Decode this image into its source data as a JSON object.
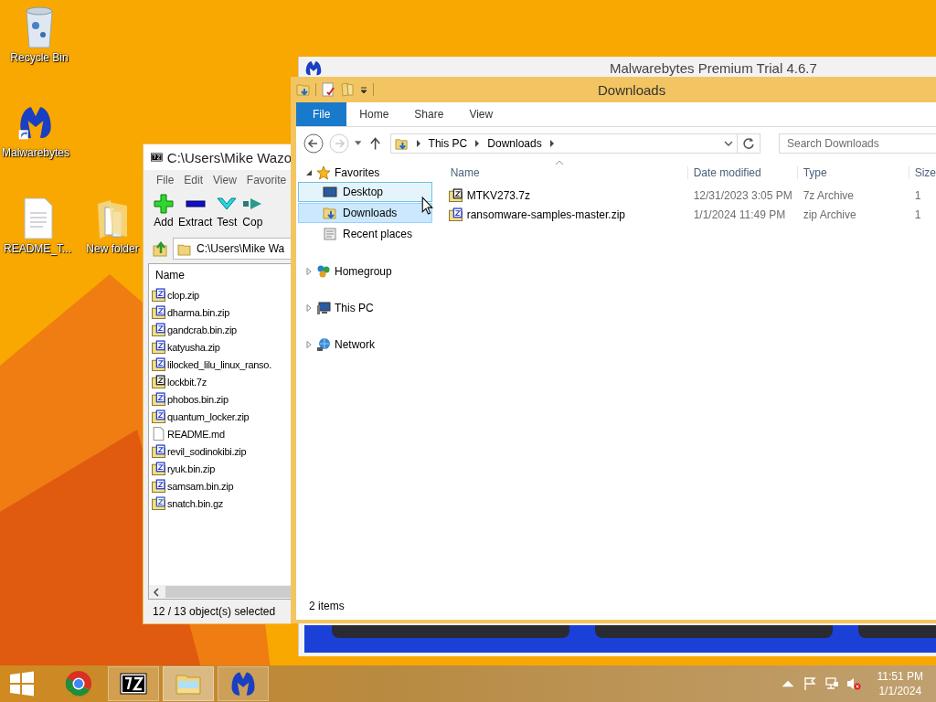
{
  "desktop_icons": [
    {
      "label": "Recycle Bin",
      "kind": "recycle"
    },
    {
      "label": "Malwarebytes",
      "kind": "malwarebytes"
    },
    {
      "label": "README_T...",
      "kind": "document"
    },
    {
      "label": "New folder",
      "kind": "folder"
    }
  ],
  "malwarebytes_window": {
    "title": "Malwarebytes Premium Trial 4.6.7"
  },
  "sevenzip_window": {
    "title": "C:\\Users\\Mike Wazo",
    "menu": [
      "File",
      "Edit",
      "View",
      "Favorite"
    ],
    "toolbar": [
      {
        "label": "Add",
        "kind": "add"
      },
      {
        "label": "Extract",
        "kind": "extract"
      },
      {
        "label": "Test",
        "kind": "test"
      },
      {
        "label": "Cop",
        "kind": "copy"
      }
    ],
    "path": "C:\\Users\\Mike Wa",
    "columns": [
      "Name"
    ],
    "files": [
      {
        "name": "clop.zip",
        "kind": "zip"
      },
      {
        "name": "dharma.bin.zip",
        "kind": "zip"
      },
      {
        "name": "gandcrab.bin.zip",
        "kind": "zip"
      },
      {
        "name": "katyusha.zip",
        "kind": "zip"
      },
      {
        "name": "lilocked_lilu_linux_ranso.",
        "kind": "zip"
      },
      {
        "name": "lockbit.7z",
        "kind": "sevenzip"
      },
      {
        "name": "phobos.bin.zip",
        "kind": "zip"
      },
      {
        "name": "quantum_locker.zip",
        "kind": "zip"
      },
      {
        "name": "README.md",
        "kind": "document"
      },
      {
        "name": "revil_sodinokibi.zip",
        "kind": "zip"
      },
      {
        "name": "ryuk.bin.zip",
        "kind": "zip"
      },
      {
        "name": "samsam.bin.zip",
        "kind": "zip"
      },
      {
        "name": "snatch.bin.gz",
        "kind": "gzip"
      }
    ],
    "status": "12 / 13 object(s) selected"
  },
  "explorer_window": {
    "title": "Downloads",
    "ribbon_tabs": [
      {
        "label": "File",
        "kind": "file"
      },
      {
        "label": "Home",
        "kind": "tab"
      },
      {
        "label": "Share",
        "kind": "tab"
      },
      {
        "label": "View",
        "kind": "tab"
      }
    ],
    "breadcrumb": [
      "This PC",
      "Downloads"
    ],
    "search": {
      "placeholder": "Search Downloads"
    },
    "nav": [
      {
        "label": "Favorites",
        "kind": "favorites",
        "expanded": true,
        "children": [
          {
            "label": "Desktop",
            "kind": "desktop",
            "selected": false,
            "hovered": true
          },
          {
            "label": "Downloads",
            "kind": "downloads",
            "selected": true,
            "hovered": false
          },
          {
            "label": "Recent places",
            "kind": "recent",
            "selected": false,
            "hovered": false
          }
        ]
      },
      {
        "label": "Homegroup",
        "kind": "homegroup",
        "expanded": false
      },
      {
        "label": "This PC",
        "kind": "pc",
        "expanded": false
      },
      {
        "label": "Network",
        "kind": "network",
        "expanded": false
      }
    ],
    "columns": [
      "Name",
      "Date modified",
      "Type",
      "Size"
    ],
    "files": [
      {
        "name": "MTKV273.7z",
        "kind": "sevenzip",
        "date": "12/31/2023 3:05 PM",
        "type": "7z Archive",
        "size": "1"
      },
      {
        "name": "ransomware-samples-master.zip",
        "kind": "zip",
        "date": "1/1/2024 11:49 PM",
        "type": "zip Archive",
        "size": "1"
      }
    ],
    "status": "2 items"
  },
  "taskbar": {
    "apps": [
      {
        "kind": "chrome",
        "running": false,
        "selected": false
      },
      {
        "kind": "sevenzip",
        "running": true,
        "selected": false
      },
      {
        "kind": "explorer",
        "running": true,
        "selected": true
      },
      {
        "kind": "malwarebytes",
        "running": true,
        "selected": false
      }
    ],
    "clock": {
      "time": "11:51 PM",
      "date": "1/1/2024"
    }
  }
}
